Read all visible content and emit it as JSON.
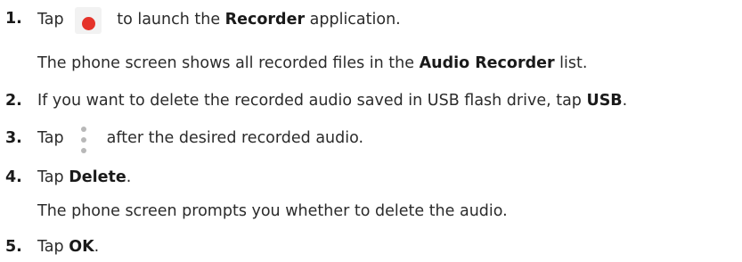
{
  "steps": [
    {
      "num": "1.",
      "pre": "Tap",
      "icon": "record-icon",
      "post": " to launch the ",
      "bold": "Recorder",
      "post2": " application."
    },
    {
      "note_pre": "The phone screen shows all recorded files in the ",
      "note_bold": "Audio Recorder",
      "note_post": " list."
    },
    {
      "num": "2.",
      "pre": "If you want to delete the recorded audio saved in USB flash drive, tap ",
      "bold": "USB",
      "post": "."
    },
    {
      "num": "3.",
      "pre": "Tap",
      "icon": "more-options-icon",
      "post": "after the desired recorded audio."
    },
    {
      "num": "4.",
      "pre": "Tap ",
      "bold": "Delete",
      "post": "."
    },
    {
      "note": "The phone screen prompts you whether to delete the audio."
    },
    {
      "num": "5.",
      "pre": "Tap ",
      "bold": "OK",
      "post": "."
    }
  ],
  "colors": {
    "text": "#2b2b2b",
    "record_dot": "#e5332a",
    "icon_bg": "#f2f2f2",
    "dots": "#b8b8b8"
  }
}
